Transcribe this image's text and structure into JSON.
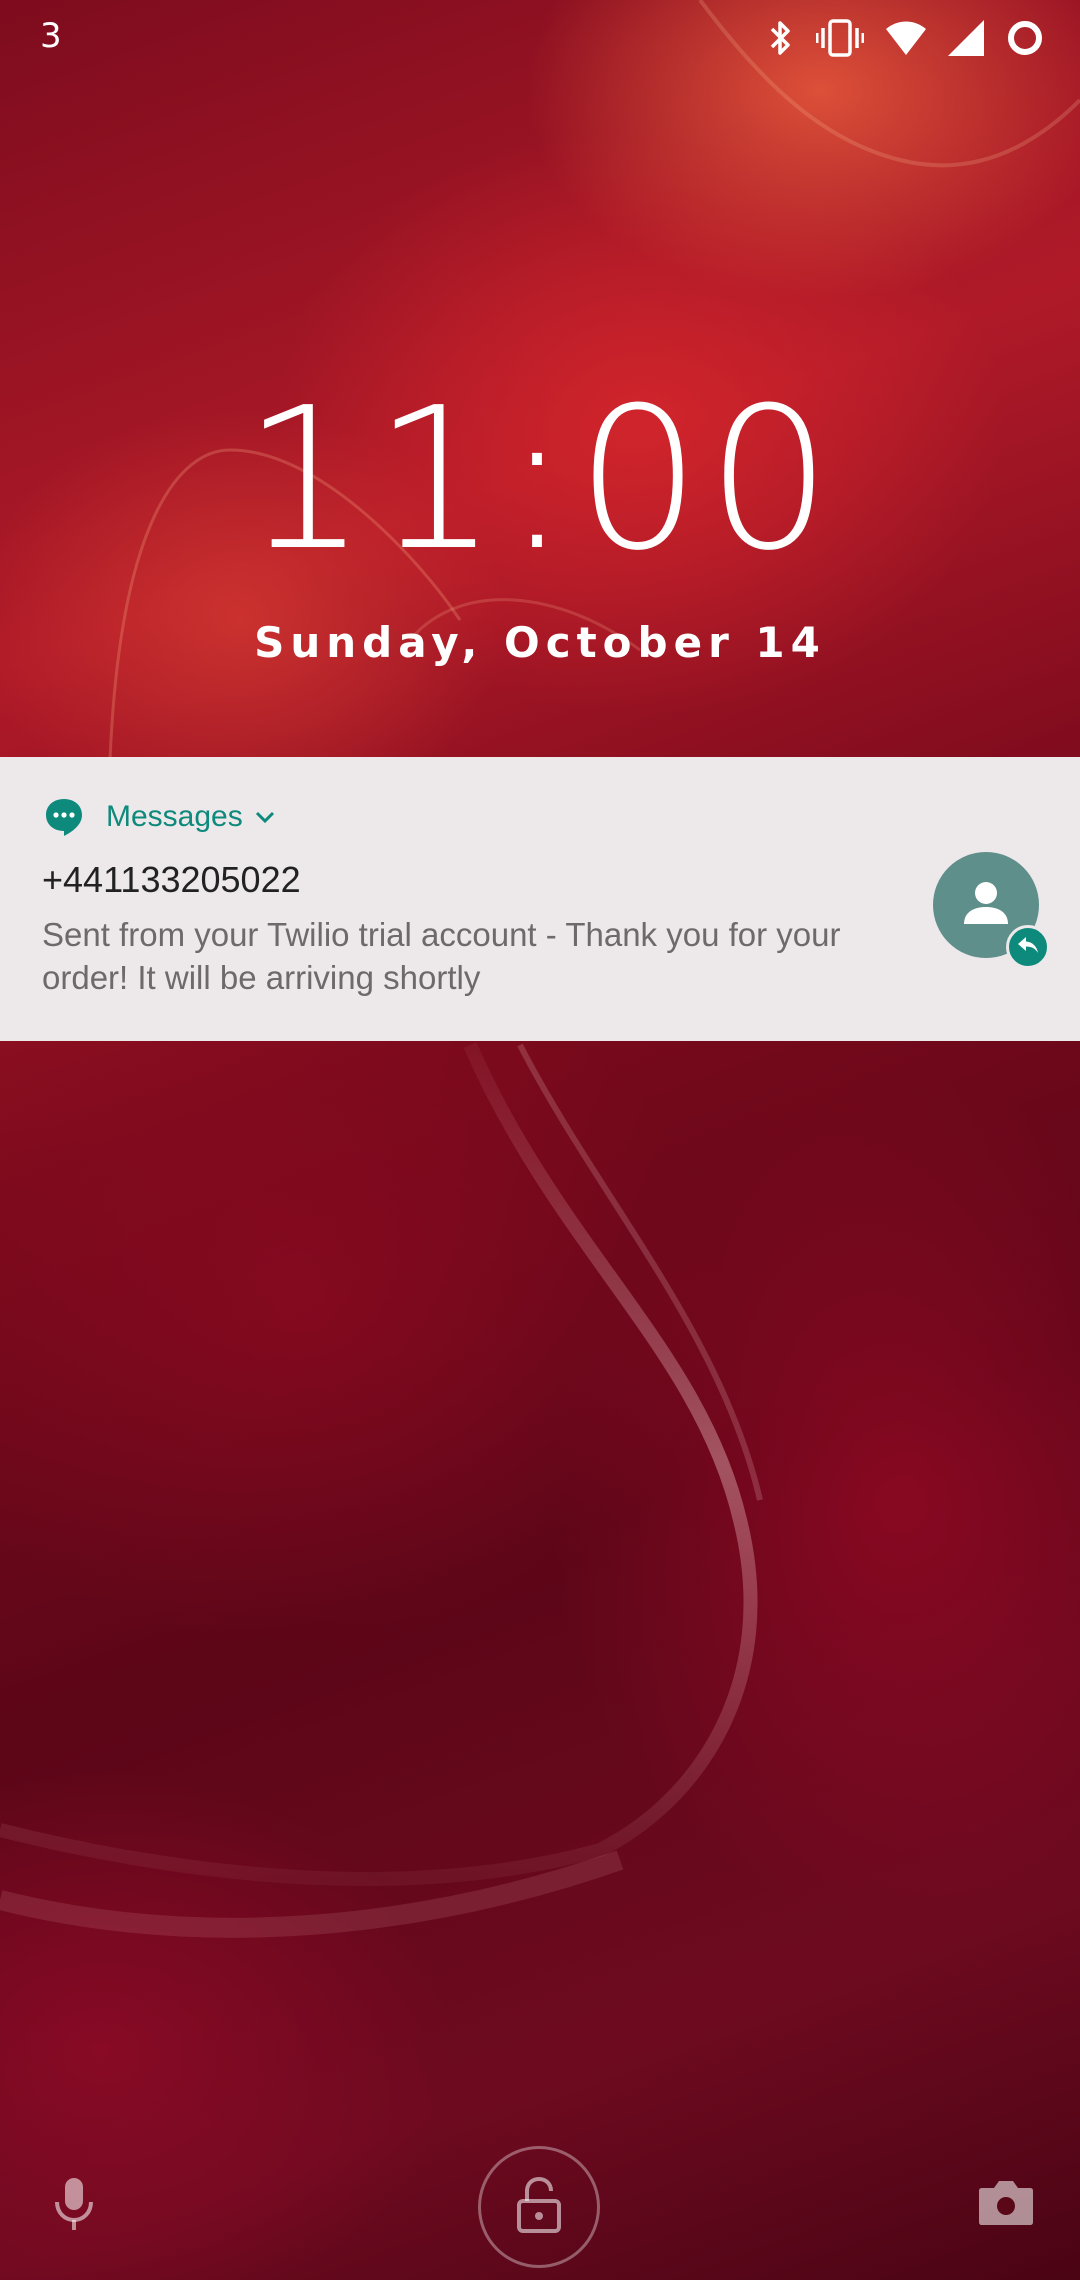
{
  "status_bar": {
    "notification_count": "3",
    "icons": [
      "bluetooth-icon",
      "vibrate-icon",
      "wifi-icon",
      "cell-signal-icon",
      "battery-ring-icon"
    ]
  },
  "lockscreen": {
    "time": "11:00",
    "date": "Sunday, October 14"
  },
  "notification": {
    "app_name": "Messages",
    "app_icon": "messages-icon",
    "sender": "+441133205022",
    "body": "Sent from your Twilio trial account - Thank you for your order! It will be arriving shortly",
    "avatar_icon": "person-icon",
    "badge_icon": "reply-icon"
  },
  "bottom_bar": {
    "left": "mic-icon",
    "center": "unlock-icon",
    "right": "camera-icon"
  },
  "colors": {
    "accent": "#0d8a7c",
    "notification_bg": "#ede8ea",
    "avatar_bg": "#5f8f8b"
  }
}
